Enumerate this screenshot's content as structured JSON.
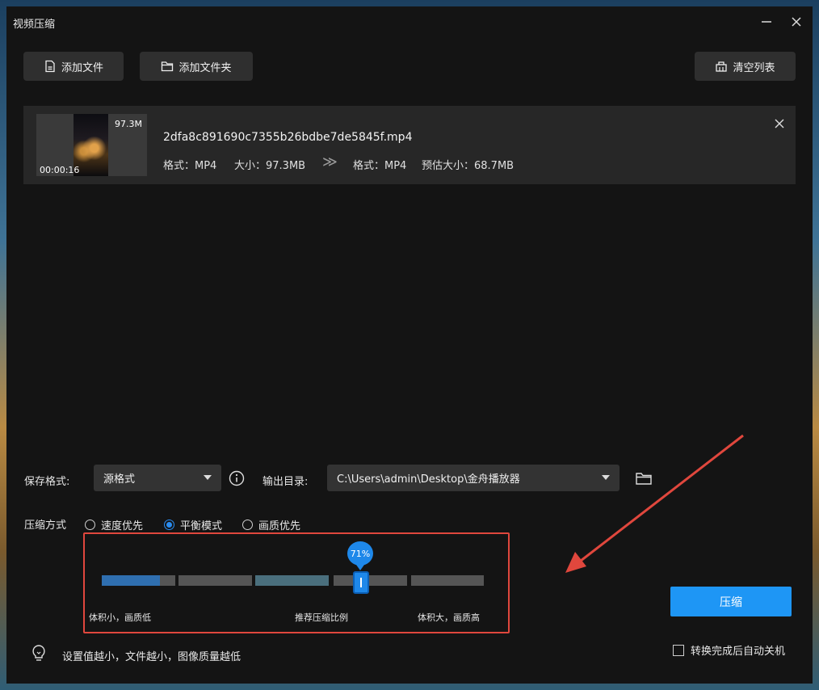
{
  "window": {
    "title": "视频压缩",
    "minimize_icon": "minimize-icon",
    "close_icon": "close-icon"
  },
  "toolbar": {
    "add_file": "添加文件",
    "add_folder": "添加文件夹",
    "clear_list": "清空列表"
  },
  "file": {
    "name": "2dfa8c891690c7355b26bdbe7de5845f.mp4",
    "thumb_size": "97.3M",
    "duration": "00:00:16",
    "src_format": "格式：MP4",
    "src_size": "大小：97.3MB",
    "arrow": "≫",
    "dst_format": "格式：MP4",
    "dst_size": "预估大小：68.7MB"
  },
  "settings": {
    "save_format_label": "保存格式:",
    "save_format_value": "源格式",
    "output_dir_label": "输出目录:",
    "output_dir_value": "C:\\Users\\admin\\Desktop\\金舟播放器"
  },
  "compression": {
    "mode_label": "压缩方式",
    "options": [
      "速度优先",
      "平衡模式",
      "画质优先"
    ],
    "selected": "平衡模式",
    "percent_label": "71%",
    "percent": 71,
    "left_caption": "体积小，画质低",
    "mid_caption": "推荐压缩比例",
    "right_caption": "体积大，画质高"
  },
  "hint": "设置值越小，文件越小，图像质量越低",
  "compress_button": "压缩",
  "auto_shutdown": {
    "label": "转换完成后自动关机",
    "checked": false
  },
  "colors": {
    "accent": "#1e96f5",
    "highlight_box": "#e0473d",
    "window_bg": "#141414"
  }
}
